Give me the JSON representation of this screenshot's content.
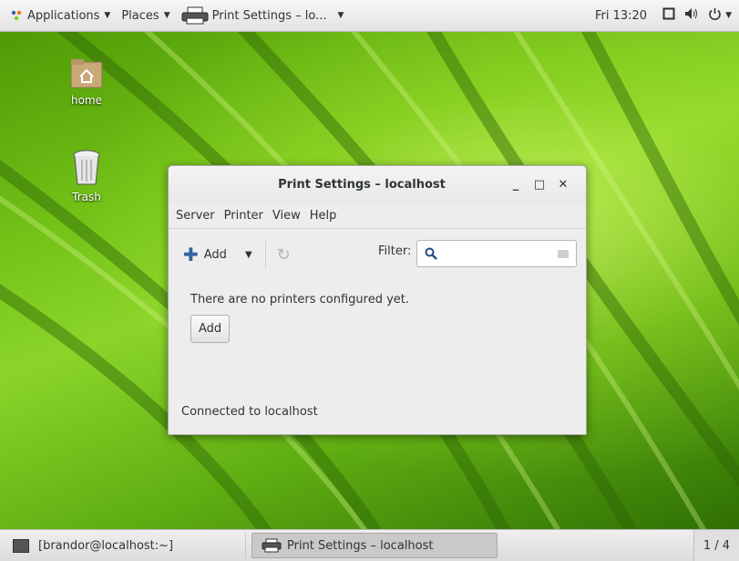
{
  "top_panel": {
    "applications": "Applications",
    "places": "Places",
    "active_window": "Print Settings – lo...",
    "clock": "Fri 13:20",
    "icons": [
      "display-icon",
      "volume-icon",
      "power-icon"
    ]
  },
  "desktop": {
    "icons": [
      {
        "label": "home",
        "icon": "home-folder-icon"
      },
      {
        "label": "Trash",
        "icon": "trash-icon"
      }
    ]
  },
  "window": {
    "title": "Print Settings – localhost",
    "controls": {
      "minimize": "_",
      "maximize": "□",
      "close": "✕"
    },
    "menu": [
      "Server",
      "Printer",
      "View",
      "Help"
    ],
    "toolbar": {
      "add_label": "Add",
      "filter_label": "Filter:",
      "filter_value": ""
    },
    "message": "There are no printers configured yet.",
    "add_button": "Add",
    "status": "Connected to localhost"
  },
  "taskbar": {
    "items": [
      {
        "label": "[brandor@localhost:~]",
        "icon": "terminal-icon",
        "active": false
      },
      {
        "label": "Print Settings – localhost",
        "icon": "printer-icon",
        "active": true
      }
    ],
    "workspace": "1 / 4"
  },
  "colors": {
    "accent": "#3465a4",
    "wallpaper": "#73c218"
  }
}
